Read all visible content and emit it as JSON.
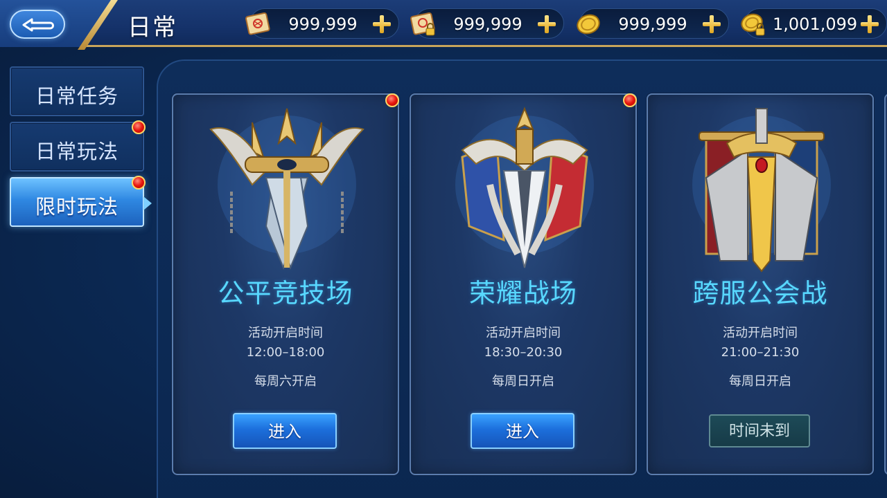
{
  "header": {
    "title": "日常",
    "resources": [
      {
        "icon": "scroll-icon",
        "value": "999,999"
      },
      {
        "icon": "locked-scroll-icon",
        "value": "999,999"
      },
      {
        "icon": "gold-coin-icon",
        "value": "999,999"
      },
      {
        "icon": "bound-gold-coin-icon",
        "value": "1,001,099"
      }
    ]
  },
  "sidebar": {
    "items": [
      {
        "label": "日常任务",
        "badge": false,
        "active": false
      },
      {
        "label": "日常玩法",
        "badge": true,
        "active": false
      },
      {
        "label": "限时玩法",
        "badge": true,
        "active": true
      }
    ]
  },
  "cards": [
    {
      "title": "公平竞技场",
      "time_label": "活动开启时间",
      "time": "12:00–18:00",
      "schedule": "每周六开启",
      "button": "进入",
      "button_enabled": true,
      "badge": true,
      "emblem": "trident-swords-emblem-icon"
    },
    {
      "title": "荣耀战场",
      "time_label": "活动开启时间",
      "time": "18:30–20:30",
      "schedule": "每周日开启",
      "button": "进入",
      "button_enabled": true,
      "badge": true,
      "emblem": "crowned-sword-banners-emblem-icon"
    },
    {
      "title": "跨服公会战",
      "time_label": "活动开启时间",
      "time": "21:00–21:30",
      "schedule": "每周日开启",
      "button": "时间未到",
      "button_enabled": false,
      "badge": false,
      "emblem": "golden-sword-banners-emblem-icon"
    }
  ],
  "colors": {
    "accent_gold": "#c9a55a",
    "title_cyan": "#58d8ff",
    "button_blue": "#1c6fdc",
    "badge_red": "#e8160d"
  }
}
